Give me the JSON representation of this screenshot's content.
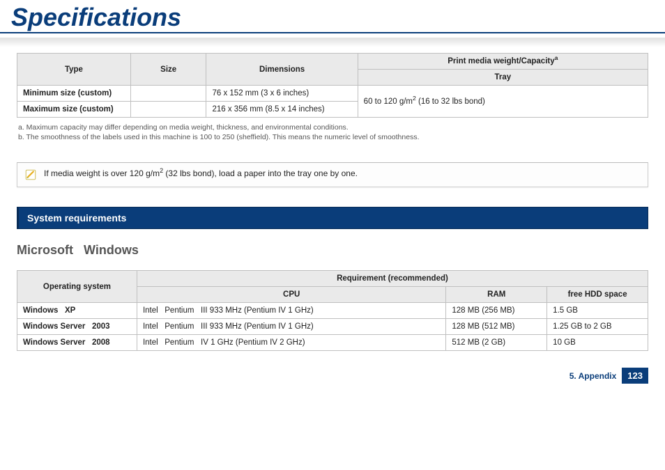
{
  "title": "Specifications",
  "table1": {
    "headers": {
      "type": "Type",
      "size": "Size",
      "dimensions": "Dimensions",
      "pmwc": "Print media weight/Capacity",
      "pmwc_sup": "a",
      "tray": "Tray"
    },
    "rows": [
      {
        "type": "Minimum size (custom)",
        "dim": "76 x 152 mm (3 x 6 inches)"
      },
      {
        "type": "Maximum size (custom)",
        "dim": "216 x 356 mm (8.5 x 14 inches)"
      }
    ],
    "tray_value_pre": "60 to 120 g/m",
    "tray_value_sup": "2",
    "tray_value_post": " (16 to 32 lbs bond)"
  },
  "footnotes": {
    "a": "a.  Maximum capacity may differ depending on media weight, thickness, and environmental conditions.",
    "b": "b.  The smoothness of the labels used in this machine is 100 to 250 (sheffield). This means the numeric level of smoothness."
  },
  "note": {
    "pre": "If media weight is over 120 g/m",
    "sup": "2",
    "post": " (32 lbs bond), load a paper into the tray one by one."
  },
  "section_bar": "System requirements",
  "subsection": "Microsoft   Windows",
  "table2": {
    "headers": {
      "os": "Operating system",
      "req": "Requirement (recommended)",
      "cpu": "CPU",
      "ram": "RAM",
      "hdd": "free HDD space"
    },
    "rows": [
      {
        "os": "Windows   XP",
        "cpu": "Intel   Pentium   III 933 MHz (Pentium IV 1 GHz)",
        "ram": "128 MB (256 MB)",
        "hdd": "1.5 GB"
      },
      {
        "os": "Windows Server   2003",
        "cpu": "Intel   Pentium   III 933 MHz (Pentium IV 1 GHz)",
        "ram": "128 MB (512 MB)",
        "hdd": "1.25 GB to 2 GB"
      },
      {
        "os": "Windows Server   2008",
        "cpu": "Intel   Pentium   IV 1 GHz (Pentium IV 2 GHz)",
        "ram": "512 MB (2 GB)",
        "hdd": "10 GB"
      }
    ]
  },
  "footer": {
    "chapter": "5. Appendix",
    "page": "123"
  }
}
